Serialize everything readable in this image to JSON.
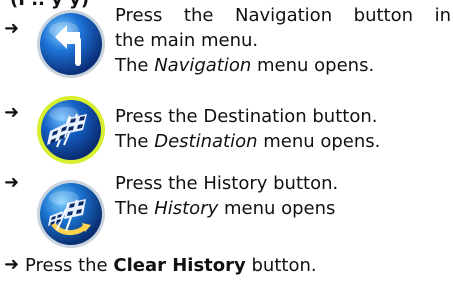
{
  "top_fragment": "(I  .. y  y)",
  "steps": [
    {
      "arrow": "➜",
      "line1": "Press the Navigation button in",
      "line2": "the main menu.",
      "result_pre": "The ",
      "result_em": "Navigation",
      "result_post": " menu opens.",
      "icon": "navigation-button-icon"
    },
    {
      "arrow": "➜",
      "line1": "Press the Destination button.",
      "result_pre": "The ",
      "result_em": "Destination",
      "result_post": " menu opens.",
      "icon": "destination-button-icon"
    },
    {
      "arrow": "➜",
      "line1": "Press the History button.",
      "result_pre": "The ",
      "result_em": "History",
      "result_post": " menu opens",
      "icon": "history-button-icon"
    }
  ],
  "final_step": {
    "arrow": "➜",
    "pre": "Press the ",
    "bold": "Clear History",
    "post": " button."
  }
}
